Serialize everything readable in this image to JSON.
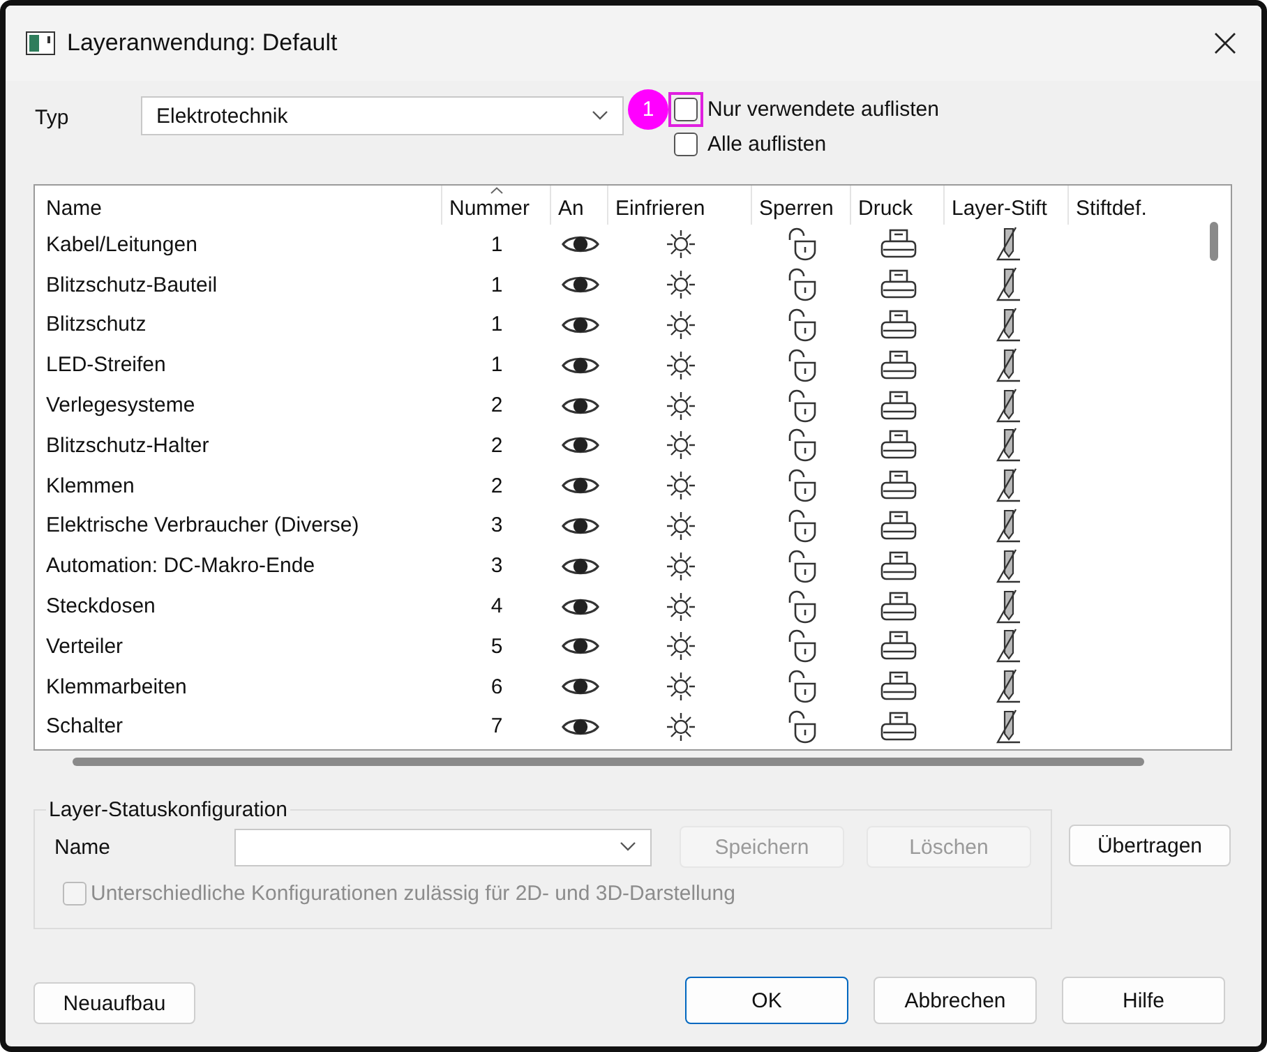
{
  "window": {
    "title": "Layeranwendung: Default"
  },
  "type_field": {
    "label": "Typ",
    "value": "Elektrotechnik"
  },
  "callout": {
    "label": "1"
  },
  "options": [
    {
      "label": "Nur verwendete auflisten",
      "checked": false,
      "highlighted": true
    },
    {
      "label": "Alle auflisten",
      "checked": false,
      "highlighted": false
    }
  ],
  "table": {
    "columns": [
      "Name",
      "Nummer",
      "An",
      "Einfrieren",
      "Sperren",
      "Druck",
      "Layer-Stift",
      "Stiftdef."
    ],
    "rows": [
      {
        "name": "Kabel/Leitungen",
        "number": "1",
        "on": true,
        "frozen": false,
        "locked": false,
        "plot": true
      },
      {
        "name": "Blitzschutz-Bauteil",
        "number": "1",
        "on": true,
        "frozen": false,
        "locked": false,
        "plot": true
      },
      {
        "name": "Blitzschutz",
        "number": "1",
        "on": true,
        "frozen": false,
        "locked": false,
        "plot": true
      },
      {
        "name": "LED-Streifen",
        "number": "1",
        "on": true,
        "frozen": false,
        "locked": false,
        "plot": true
      },
      {
        "name": "Verlegesysteme",
        "number": "2",
        "on": true,
        "frozen": false,
        "locked": false,
        "plot": true
      },
      {
        "name": "Blitzschutz-Halter",
        "number": "2",
        "on": true,
        "frozen": false,
        "locked": false,
        "plot": true
      },
      {
        "name": "Klemmen",
        "number": "2",
        "on": true,
        "frozen": false,
        "locked": false,
        "plot": true
      },
      {
        "name": "Elektrische Verbraucher (Diverse)",
        "number": "3",
        "on": true,
        "frozen": false,
        "locked": false,
        "plot": true
      },
      {
        "name": "Automation: DC-Makro-Ende",
        "number": "3",
        "on": true,
        "frozen": false,
        "locked": false,
        "plot": true
      },
      {
        "name": "Steckdosen",
        "number": "4",
        "on": true,
        "frozen": false,
        "locked": false,
        "plot": true
      },
      {
        "name": "Verteiler",
        "number": "5",
        "on": true,
        "frozen": false,
        "locked": false,
        "plot": true
      },
      {
        "name": "Klemmarbeiten",
        "number": "6",
        "on": true,
        "frozen": false,
        "locked": false,
        "plot": true
      },
      {
        "name": "Schalter",
        "number": "7",
        "on": true,
        "frozen": false,
        "locked": false,
        "plot": true
      }
    ]
  },
  "status_config": {
    "title": "Layer-Statuskonfiguration",
    "name_label": "Name",
    "buttons": [
      {
        "label": "Speichern",
        "disabled": true
      },
      {
        "label": "Löschen",
        "disabled": true
      }
    ],
    "option": {
      "label": "Unterschiedliche Konfigurationen zulässig für 2D- und 3D-Darstellung",
      "checked": false,
      "disabled": true
    }
  },
  "transfer_button": "Übertragen",
  "rebuild_button": "Neuaufbau",
  "buttons": [
    {
      "label": "OK",
      "default": true
    },
    {
      "label": "Abbrechen",
      "default": false
    },
    {
      "label": "Hilfe",
      "default": false
    }
  ]
}
